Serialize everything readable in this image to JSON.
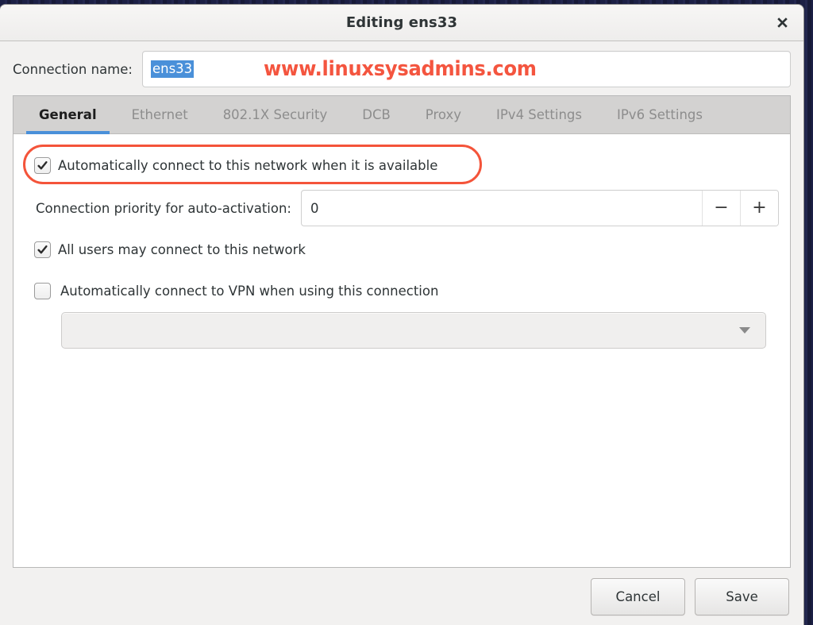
{
  "window": {
    "title": "Editing ens33",
    "close_icon": "close-icon"
  },
  "connection": {
    "label": "Connection name:",
    "value": "ens33",
    "placeholder": ""
  },
  "watermark": {
    "text": "www.linuxsysadmins.com",
    "color": "#f4553f"
  },
  "tabs": [
    {
      "label": "General",
      "active": true
    },
    {
      "label": "Ethernet",
      "active": false
    },
    {
      "label": "802.1X Security",
      "active": false
    },
    {
      "label": "DCB",
      "active": false
    },
    {
      "label": "Proxy",
      "active": false
    },
    {
      "label": "IPv4 Settings",
      "active": false
    },
    {
      "label": "IPv6 Settings",
      "active": false
    }
  ],
  "general": {
    "auto_connect": {
      "label": "Automatically connect to this network when it is available",
      "checked": true,
      "highlighted": true,
      "highlight_color": "#f4543a"
    },
    "priority": {
      "label": "Connection priority for auto-activation:",
      "value": "0",
      "decrement_label": "−",
      "increment_label": "+"
    },
    "all_users": {
      "label": "All users may connect to this network",
      "checked": true
    },
    "auto_vpn": {
      "label": "Automatically connect to VPN when using this connection",
      "checked": false
    },
    "vpn_combo": {
      "value": "",
      "arrow_icon": "chevron-down-icon"
    }
  },
  "footer": {
    "cancel_label": "Cancel",
    "save_label": "Save"
  },
  "theme": {
    "accent": "#4a90d9",
    "selection_bg": "#4a90d9",
    "window_bg": "#f2f1f0"
  }
}
